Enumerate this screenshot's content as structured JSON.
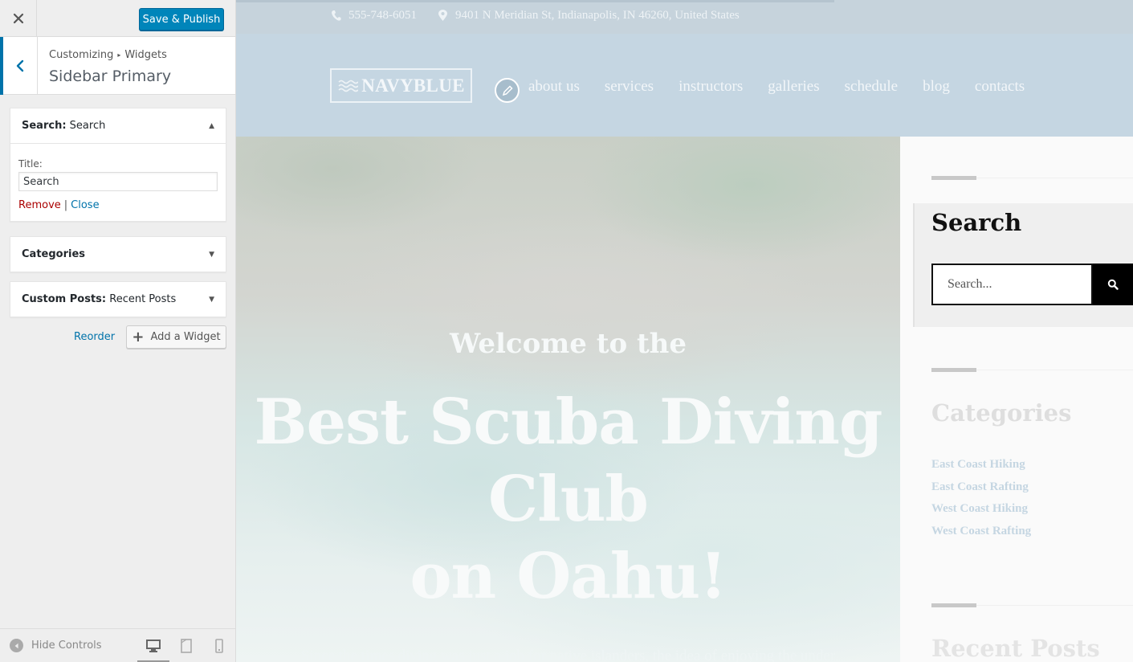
{
  "customizer": {
    "publish_label": "Save & Publish",
    "breadcrumb": {
      "root": "Customizing",
      "separator": "▸",
      "current": "Widgets"
    },
    "section_title": "Sidebar Primary",
    "widgets": [
      {
        "type": "Search:",
        "name": "Search",
        "expanded": true,
        "title_label": "Title:",
        "title_value": "Search",
        "remove_label": "Remove",
        "pipe": "|",
        "close_label": "Close"
      },
      {
        "type": "Categories",
        "name": "",
        "expanded": false
      },
      {
        "type": "Custom Posts:",
        "name": "Recent Posts",
        "expanded": false
      }
    ],
    "toggle_up": "▲",
    "toggle_down": "▼",
    "reorder_label": "Reorder",
    "add_widget_label": "Add a Widget",
    "add_widget_icon": "+",
    "hide_controls_label": "Hide Controls",
    "devices": [
      "desktop",
      "tablet",
      "mobile"
    ],
    "active_device": "desktop"
  },
  "preview": {
    "topbar": {
      "phone": "555-748-6051",
      "address": "9401 N Meridian St, Indianapolis, IN 46260, United States"
    },
    "logo": "NAVYBLUE",
    "menu": [
      "about us",
      "services",
      "instructors",
      "galleries",
      "schedule",
      "blog",
      "contacts"
    ],
    "hero": {
      "subtitle": "Welcome to the",
      "title_line1": "Best Scuba Diving",
      "title_line2": "Club",
      "title_line3": "on Oahu!",
      "description": "Since the times diving was just a job for native islanders, the idea of enjoying the under"
    },
    "sidebar": {
      "search_title": "Search",
      "search_placeholder": "Search...",
      "categories_title": "Categories",
      "categories": [
        "East Coast Hiking",
        "East Coast Rafting",
        "West Coast Hiking",
        "West Coast Rafting"
      ],
      "recent_posts_title": "Recent Posts"
    }
  },
  "colors": {
    "primary_button": "#0085ba",
    "link": "#0073aa",
    "remove_link": "#aa0000",
    "nav_background": "#c5d6e2",
    "topbar_background": "#c6d3dc"
  }
}
